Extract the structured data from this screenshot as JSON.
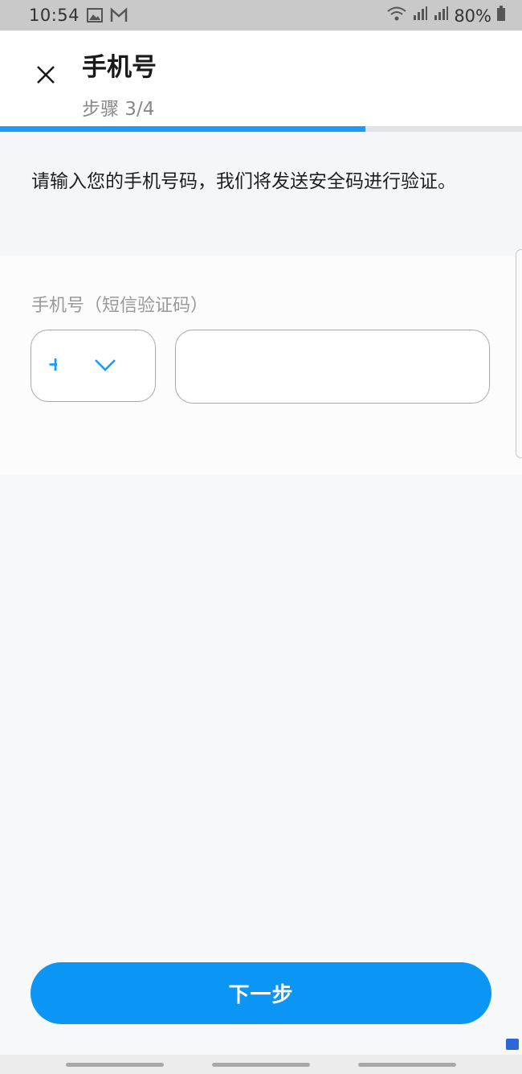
{
  "status_bar": {
    "time": "10:54",
    "battery": "80%"
  },
  "header": {
    "title": "手机号",
    "step": "步骤 3/4",
    "progress": 0.7
  },
  "intro": {
    "text": "请输入您的手机号码，我们将发送安全码进行验证。"
  },
  "form": {
    "phone_label": "手机号（短信验证码）",
    "country_code": "+",
    "phone_value": "",
    "phone_placeholder": ""
  },
  "footer": {
    "next_label": "下一步"
  },
  "colors": {
    "accent": "#0b96f5",
    "progress_track": "#e1e3e6",
    "border": "#a9a9a9"
  },
  "icons": {
    "close": "close-icon",
    "chevron": "chevron-down-icon",
    "image": "image-icon",
    "mail": "mail-icon",
    "wifi": "wifi-icon",
    "signal": "signal-icon",
    "battery": "battery-icon"
  }
}
